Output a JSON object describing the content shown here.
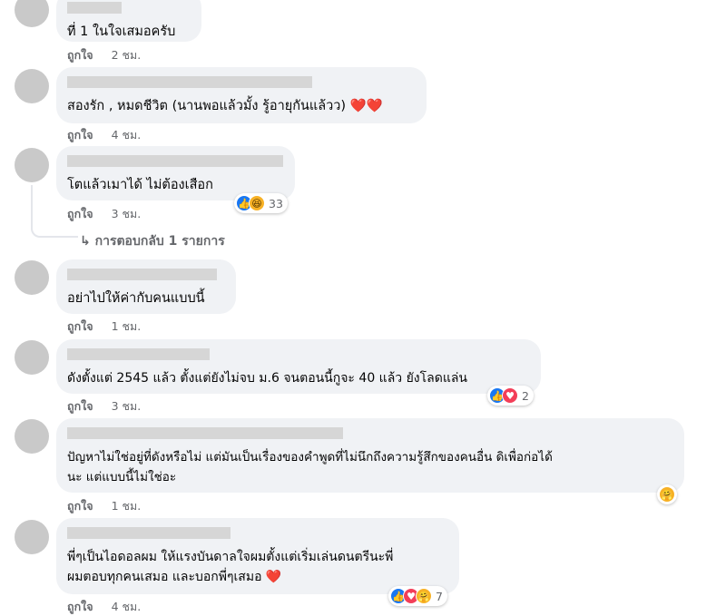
{
  "comments": [
    {
      "text": "ที่ 1 ในใจเสมอครับ",
      "like_label": "ถูกใจ",
      "time": "2 ชม."
    },
    {
      "text": "สองรัก , หมดชีวิต (นานพอแล้วมั้ง รู้อายุกันแล้วว) ❤️❤️",
      "like_label": "ถูกใจ",
      "time": "4 ชม."
    },
    {
      "text": "โตแล้วเมาได้ ไม่ต้องเสือก",
      "like_label": "ถูกใจ",
      "time": "3 ชม.",
      "reaction_count": "33",
      "replies_label": "↳ การตอบกลับ 1 รายการ"
    },
    {
      "text": "อย่าไปให้ค่ากับคนแบบนี้",
      "like_label": "ถูกใจ",
      "time": "1 ชม."
    },
    {
      "text": "ดังตั้งแต่ 2545 แล้ว ตั้งแต่ยังไม่จบ ม.6 จนตอนนี้กูจะ 40 แล้ว ยังโลดแล่น",
      "like_label": "ถูกใจ",
      "time": "3 ชม.",
      "reaction_count": "2"
    },
    {
      "text": "ปัญหาไม่ใช่อยู่ที่ดังหรือไม่ แต่มันเป็นเรื่องของคำพูดที่ไม่นึกถึงความรู้สึกของคนอื่น ดิเพื่อก่อได้\nนะ แต่แบบนี้ไม่ใช่อะ",
      "like_label": "ถูกใจ",
      "time": "1 ชม."
    },
    {
      "text": "พี่ๆเป็นไอดอลผม ให้แรงบันดาลใจผมตั้งแต่เริ่มเล่นดนตรีนะพี่\nผมตอบทุกคนเสมอ และบอกพี่ๆเสมอ ❤️",
      "like_label": "ถูกใจ",
      "time": "4 ชม.",
      "reaction_count": "7"
    }
  ],
  "reaction_icons": {
    "like": "👍",
    "love": "♥",
    "haha": "😆",
    "care": "🤗"
  },
  "colors": {
    "bubble": "#f0f2f5",
    "meta_text": "#65676b",
    "like_blue": "#1877f2",
    "love_red": "#f33e58"
  }
}
